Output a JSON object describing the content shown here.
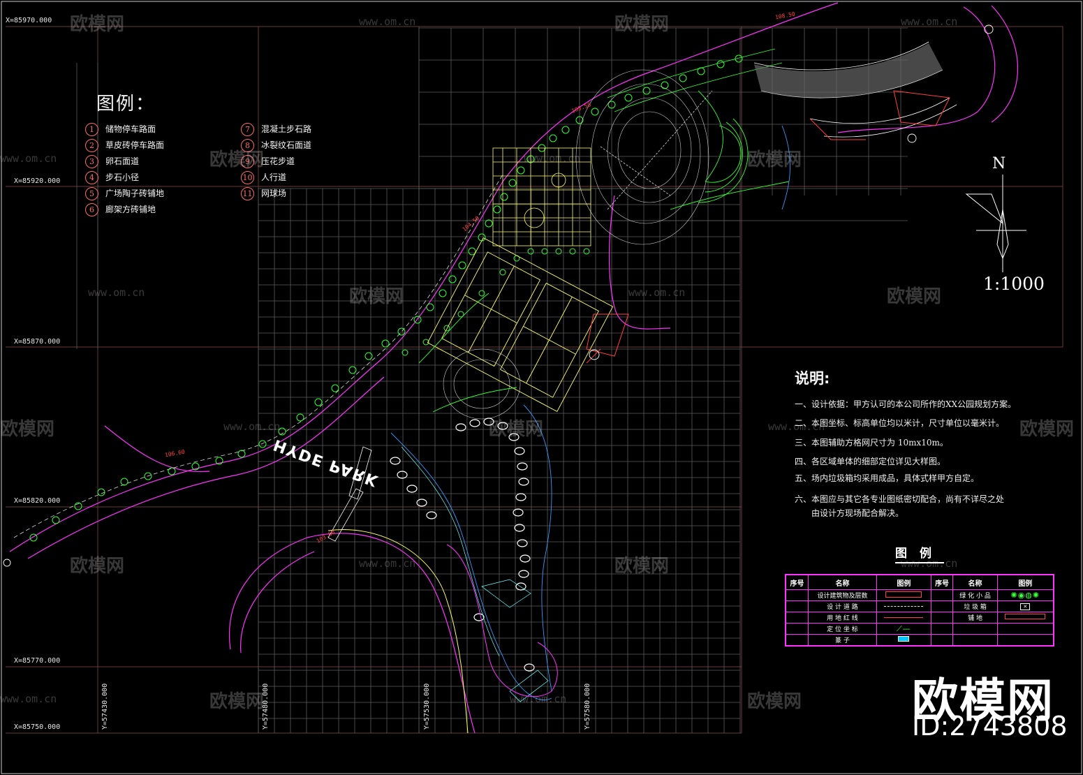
{
  "title_legend": "图例：",
  "legend_items": [
    {
      "num": "1",
      "label": "储物停车路面"
    },
    {
      "num": "2",
      "label": "草皮砖停车路面"
    },
    {
      "num": "3",
      "label": "卵石面道"
    },
    {
      "num": "4",
      "label": "步石小径"
    },
    {
      "num": "5",
      "label": "广场陶子砖铺地"
    },
    {
      "num": "6",
      "label": "廊架方砖铺地"
    },
    {
      "num": "7",
      "label": "混凝土步石路"
    },
    {
      "num": "8",
      "label": "冰裂纹石面道"
    },
    {
      "num": "9",
      "label": "压花步道"
    },
    {
      "num": "10",
      "label": "人行道"
    },
    {
      "num": "11",
      "label": "网球场"
    }
  ],
  "coords_x": [
    "X=85970.000",
    "X=85920.000",
    "X=85870.000",
    "X=85820.000",
    "X=85770.000",
    "X=85750.000"
  ],
  "coords_y": [
    "Y=57430.000",
    "Y=57480.000",
    "Y=57530.000",
    "Y=57580.000"
  ],
  "north": "N",
  "scale": "1:1000",
  "notes": {
    "title": "说明:",
    "items": [
      "一、设计依据：甲方认可的本公司所作的XX公园规划方案。",
      "二、本图坐标、标高单位均以米计，尺寸单位以毫米计。",
      "三、本图辅助方格网尺寸为 10mx10m。",
      "四、各区域单体的细部定位详见大样图。",
      "五、场内垃圾箱均采用成品，具体式样甲方自定。",
      "六、本图应与其它各专业图纸密切配合，尚有不详尽之处",
      "由设计方现场配合解决。"
    ]
  },
  "table": {
    "title": "图例",
    "headers": [
      "序号",
      "名称",
      "图例",
      "序号",
      "名称",
      "图例"
    ],
    "rows": [
      {
        "name_left": "设计建筑物及层数",
        "name_right": "绿 化 小 品"
      },
      {
        "name_left": "设 计 道 路",
        "name_right": "垃 圾 箱"
      },
      {
        "name_left": "用 地 红 线",
        "name_right": "铺 地"
      },
      {
        "name_left": "定 位 坐 标",
        "name_right": ""
      },
      {
        "name_left": "篆 子",
        "name_right": ""
      }
    ]
  },
  "map_text": {
    "park": "HYDE PARK",
    "levels": [
      "106.60",
      "104.50",
      "105.50",
      "108.50",
      "103.60"
    ]
  },
  "watermark": {
    "text": "欧模网",
    "url": "www.om.cn"
  },
  "brand": {
    "name": "欧模网",
    "id": "ID:2743808"
  },
  "colors": {
    "background": "#000000",
    "grid_dark": "#5a2a2a",
    "grid_light": "#808080",
    "boundary": "#ff33ff",
    "green": "#33ff33",
    "yellow": "#ffff66",
    "white": "#ffffff",
    "blue": "#3399ff",
    "red": "#ff4040"
  }
}
